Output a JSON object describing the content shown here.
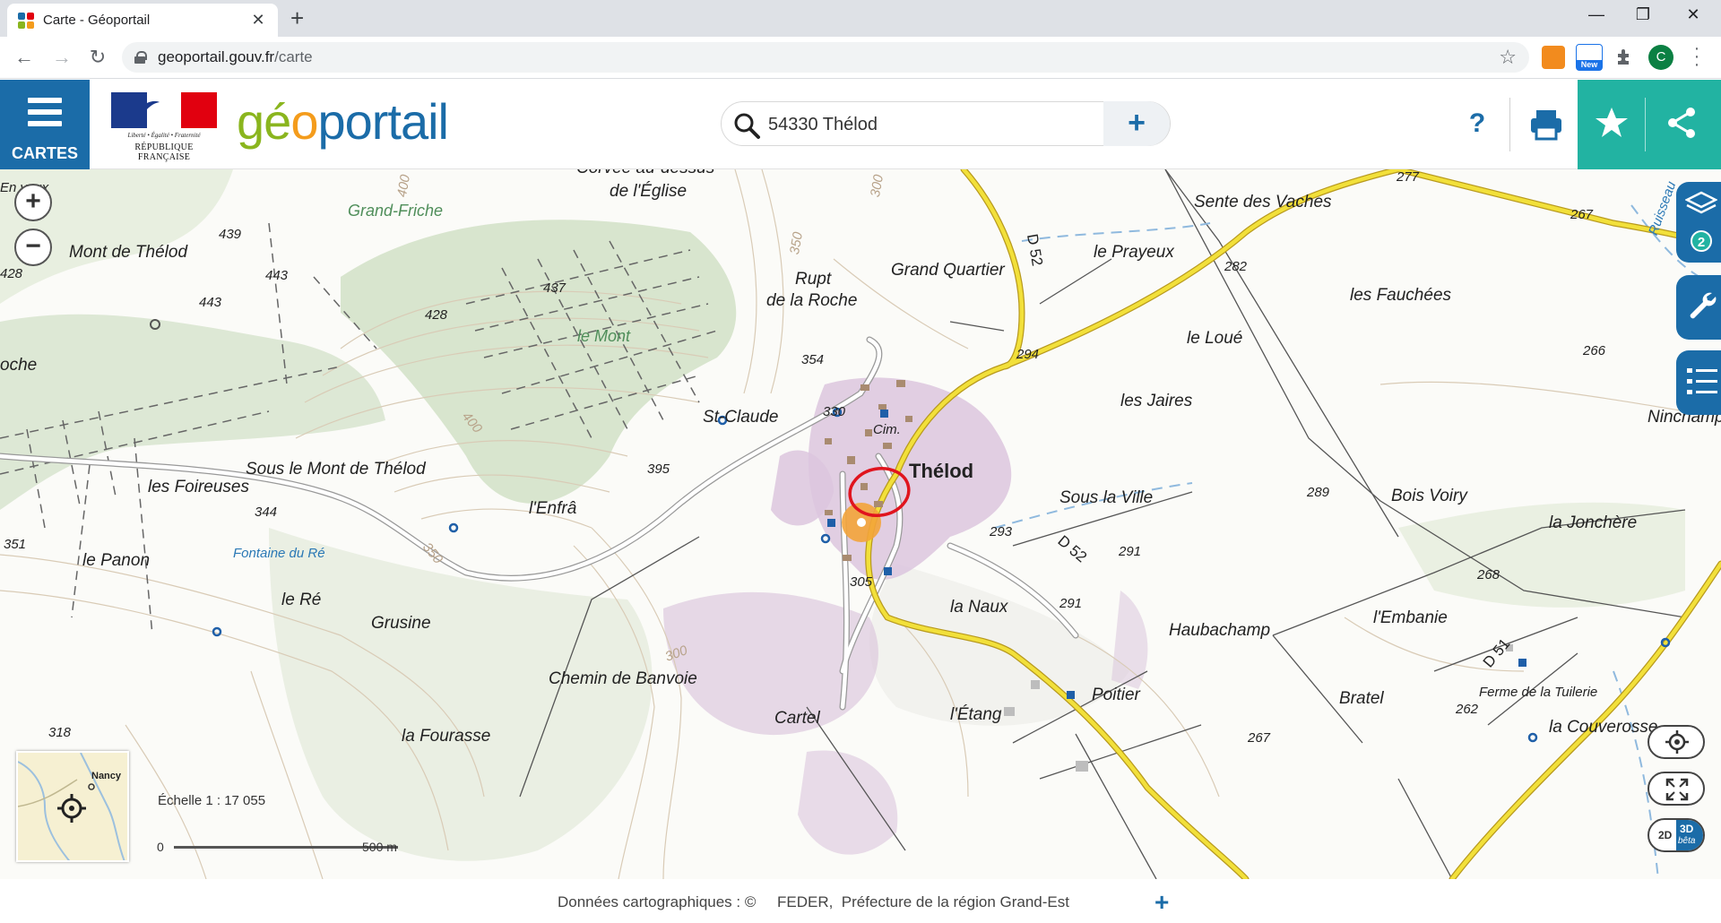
{
  "browser": {
    "tab_title": "Carte - Géoportail",
    "url_host": "geoportail.gouv.fr",
    "url_path": "/carte",
    "new_badge": "New",
    "profile_initial": "C"
  },
  "header": {
    "cartes_label": "CARTES",
    "rf_motto": "Liberté • Égalité • Fraternité",
    "rf_name": "RÉPUBLIQUE FRANÇAISE",
    "logo_g": "g",
    "logo_e": "é",
    "logo_o": "o",
    "logo_rest": "portail",
    "search_value": "54330 Thélod",
    "help_label": "?",
    "search_add_label": "+"
  },
  "map": {
    "labels": {
      "corvee": "Corvée au-dessus",
      "eglise": "de l'Église",
      "grand_friche": "Grand-Friche",
      "mont_thelod": "Mont de Thélod",
      "en_vaux": "En vaux",
      "le_mont": "le Mont",
      "rupt": "Rupt",
      "de_la_roche": "de la Roche",
      "grand_quartier": "Grand Quartier",
      "sente": "Sente des Vaches",
      "prayeux": "le Prayeux",
      "fauchees": "les Fauchées",
      "loue": "le Loué",
      "jaires": "les Jaires",
      "ninchamp": "Ninchamp",
      "st_claude": "St-Claude",
      "cim": "Cim.",
      "thelod": "Thélod",
      "sous_mont": "Sous le Mont de Thélod",
      "foireuses": "les Foireuses",
      "enfra": "l'Enfrâ",
      "sous_ville": "Sous la Ville",
      "bois_voiry": "Bois Voiry",
      "joncheres": "la Jonchère",
      "roche": "oche",
      "panon": "le Panon",
      "fontaine": "Fontaine du Ré",
      "le_re": "le Ré",
      "grusine": "Grusine",
      "naux": "la Naux",
      "haubachamp": "Haubachamp",
      "embanie": "l'Embanie",
      "ferme": "Ferme de la Tuilerie",
      "banvoie": "Chemin de Banvoie",
      "poitier": "Poitier",
      "bratel": "Bratel",
      "cartel": "Cartel",
      "etang": "l'Étang",
      "couverosse": "la Couverosse",
      "fourasse": "la Fourasse",
      "ruisseau": "Ruisseau",
      "d52_north": "D 52",
      "d52_south": "D 52",
      "d51": "D 51"
    },
    "elevations": {
      "e439": "439",
      "e443a": "443",
      "e443b": "443",
      "e437": "437",
      "e428a": "428",
      "e428b": "428",
      "e354": "354",
      "e330": "330",
      "e395": "395",
      "e344": "344",
      "e351": "351",
      "e305": "305",
      "e293": "293",
      "e294": "294",
      "e282": "282",
      "e277": "277",
      "e267a": "267",
      "e266": "266",
      "e289": "289",
      "e291a": "291",
      "e291b": "291",
      "e268": "268",
      "e262": "262",
      "e318": "318",
      "e267b": "267",
      "c400a": "400",
      "c300a": "300",
      "c350a": "350",
      "c400b": "400",
      "c350b": "350",
      "c300b": "300"
    },
    "minimap_label": "Nancy",
    "scale_label": "Échelle 1 : 17 055",
    "scale_start": "0",
    "scale_end": "500 m",
    "layers_count": "2",
    "btn_2d": "2D",
    "btn_3d": "3D",
    "btn_beta": "bêta"
  },
  "footer": {
    "text": "Données cartographiques : ©     FEDER,  Préfecture de la région Grand-Est",
    "plus": "+"
  }
}
